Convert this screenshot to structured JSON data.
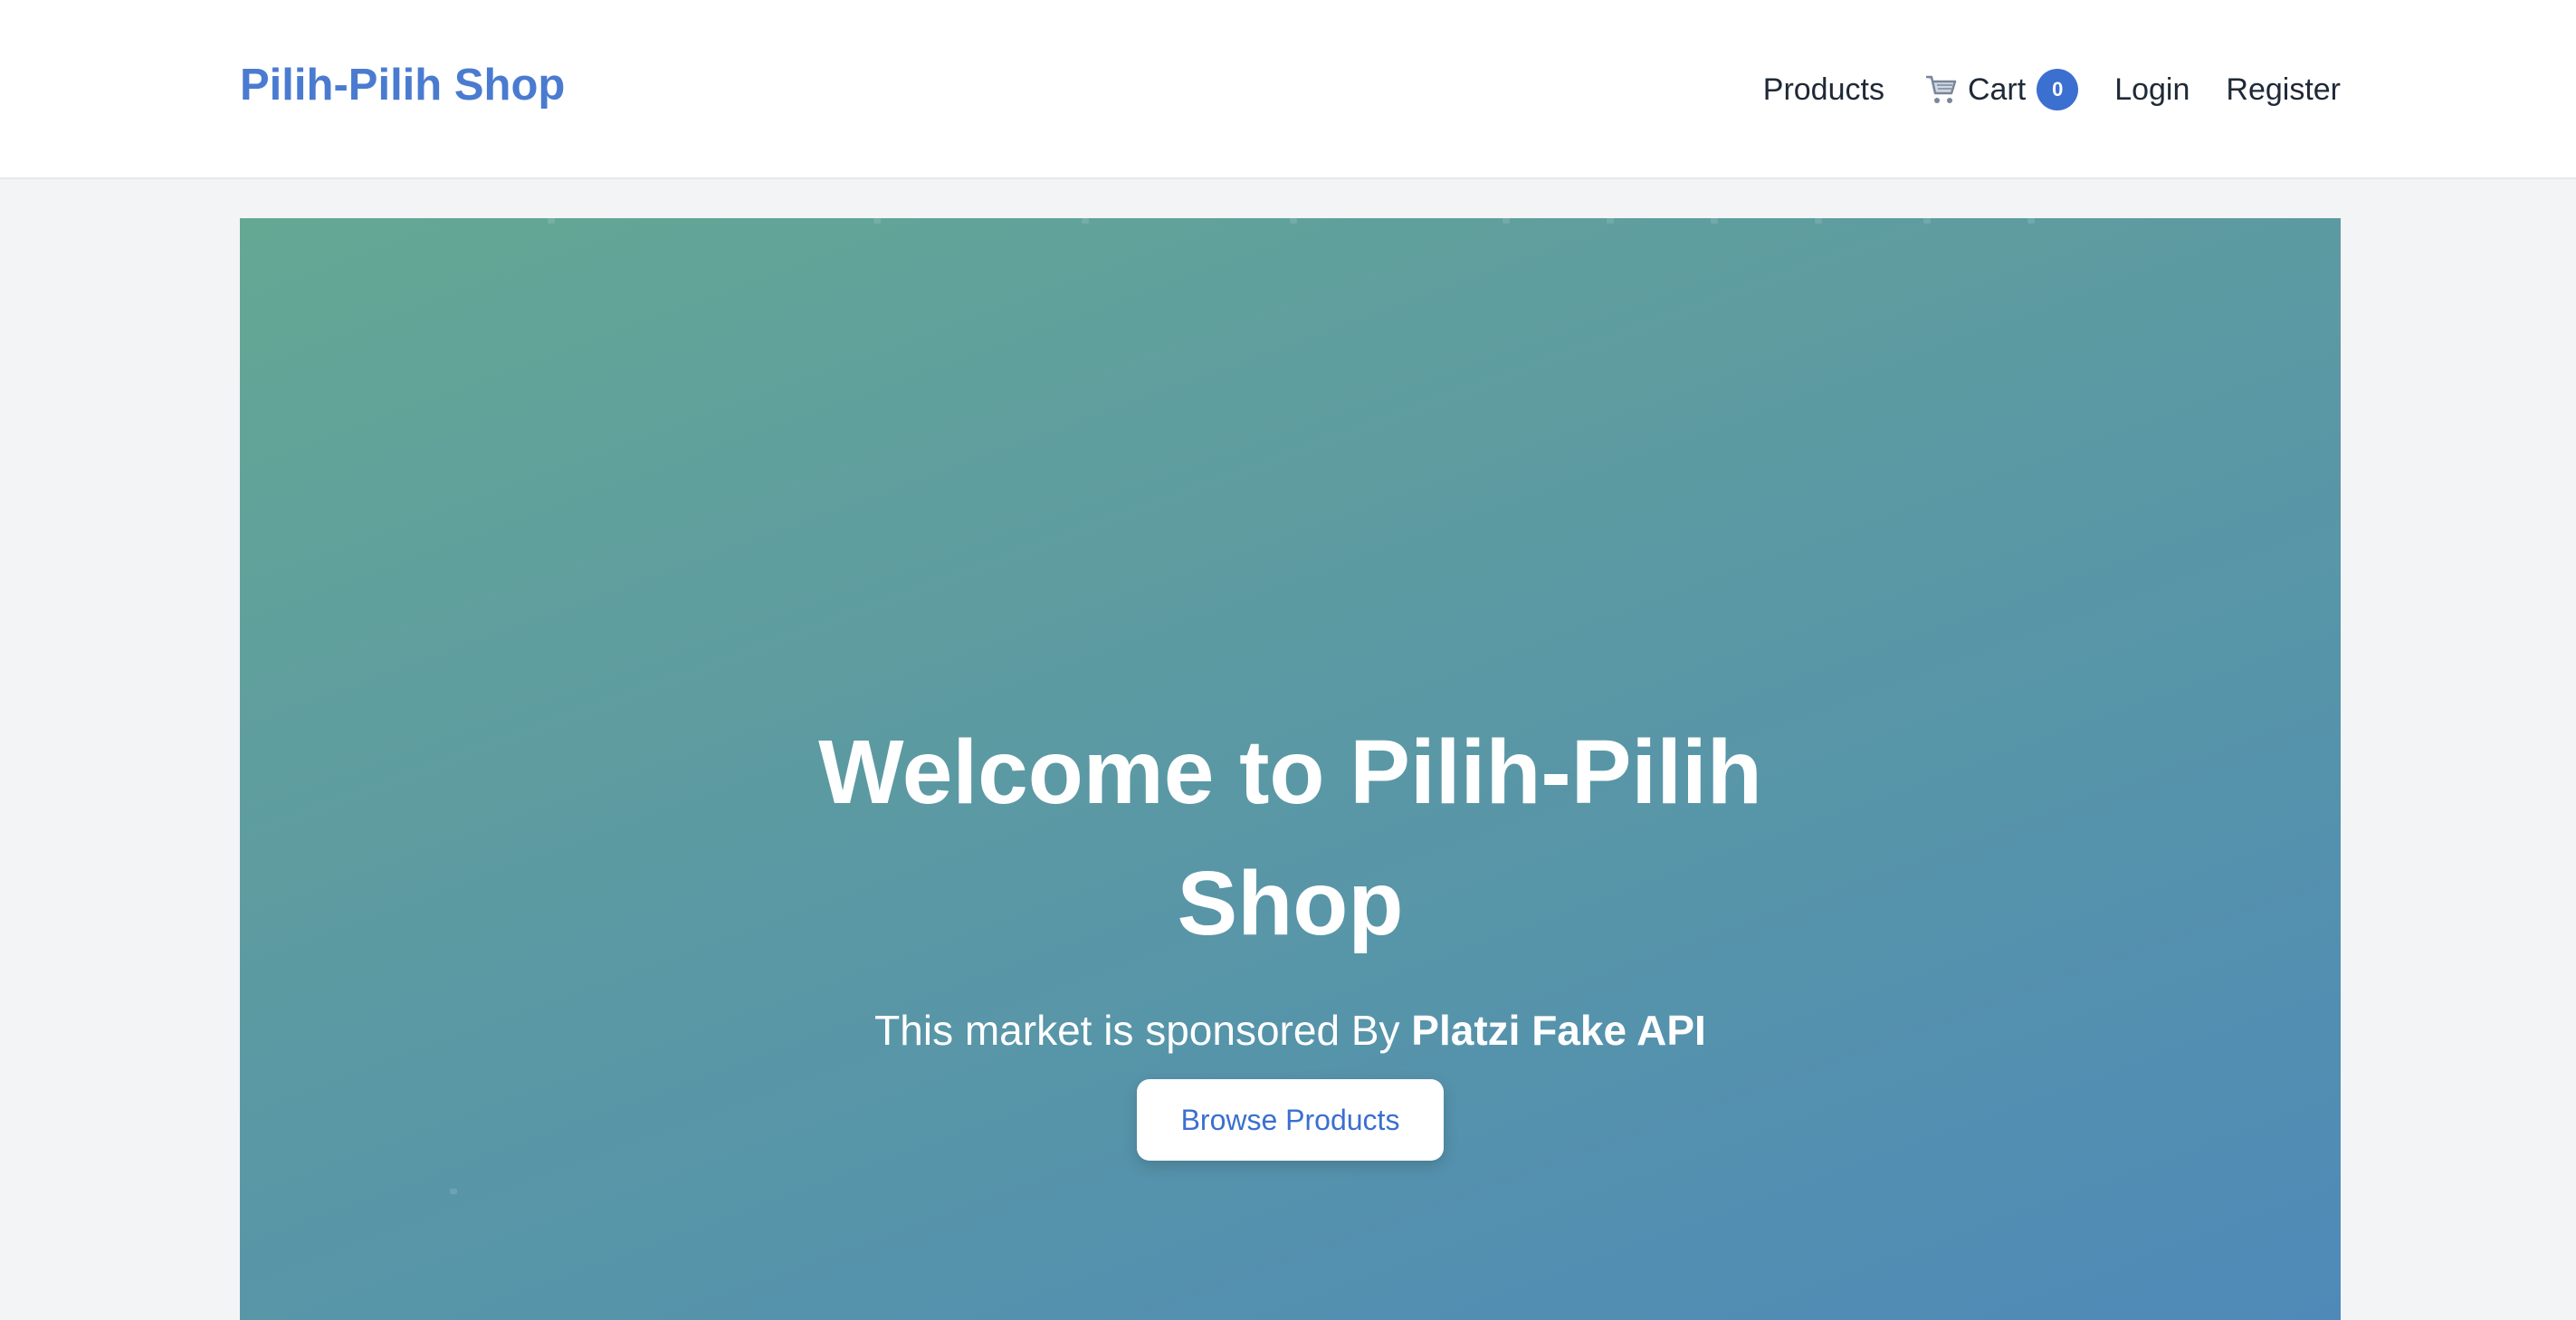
{
  "header": {
    "brand": "Pilih-Pilih Shop",
    "nav": {
      "products": "Products",
      "cart": "Cart",
      "cart_count": "0",
      "login": "Login",
      "register": "Register"
    },
    "cart_icon": "shopping-cart-icon"
  },
  "hero": {
    "title_line1": "Welcome to Pilih-Pilih",
    "title_line2": "Shop",
    "subtitle_prefix": "This market is sponsored By ",
    "subtitle_sponsor": "Platzi Fake API",
    "cta": "Browse Products"
  },
  "colors": {
    "brand": "#4a7bd0",
    "badge": "#3b6fd0",
    "hero_start": "#64a894",
    "hero_end": "#4f89b8"
  }
}
